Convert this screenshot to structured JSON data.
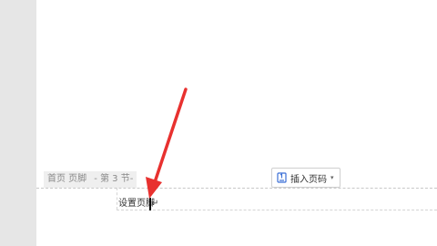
{
  "footer": {
    "tab": {
      "label": "首页 页脚",
      "section": "- 第 3 节-"
    },
    "insert_page_number_button": {
      "label": "插入页码",
      "caret": "▾",
      "icon": "page-number-icon"
    },
    "text": "设置页脚"
  },
  "colors": {
    "arrow": "#e8312f",
    "accent_icon": "#3b6fd6"
  }
}
